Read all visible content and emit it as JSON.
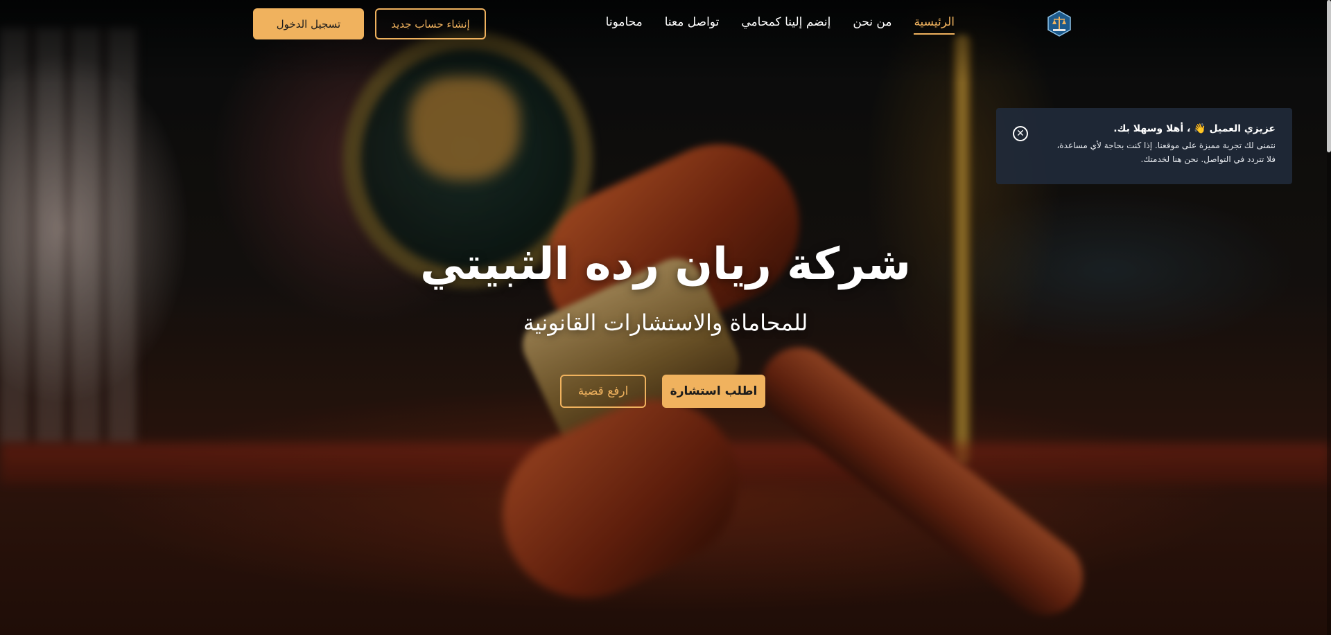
{
  "brand": {
    "accent": "#f0b25e",
    "logo_icon": "scales-hexagon-logo-icon"
  },
  "nav": {
    "items": [
      {
        "label": "الرئيسية",
        "active": true
      },
      {
        "label": "من نحن",
        "active": false
      },
      {
        "label": "إنضم إلينا كمحامي",
        "active": false
      },
      {
        "label": "تواصل معنا",
        "active": false
      },
      {
        "label": "محامونا",
        "active": false
      }
    ]
  },
  "auth": {
    "register_label": "إنشاء حساب جديد",
    "login_label": "تسجيل الدخول"
  },
  "toast": {
    "title": "عزيزي العميل 👋 ، أهلا وسهلا بك.",
    "line1": "نتمنى لك تجربة مميزة على موقعنا. إذا كنت بحاجة لأي مساعدة،",
    "line2": "فلا تتردد في التواصل. نحن هنا لخدمتك.",
    "close_icon": "close-circle-icon",
    "background": "#202a3a"
  },
  "hero": {
    "title": "شركة ريان رده الثبيتي",
    "subtitle": "للمحاماة والاستشارات القانونية",
    "primary_cta": "اطلب استشارة",
    "secondary_cta": "ارفع قضية"
  }
}
